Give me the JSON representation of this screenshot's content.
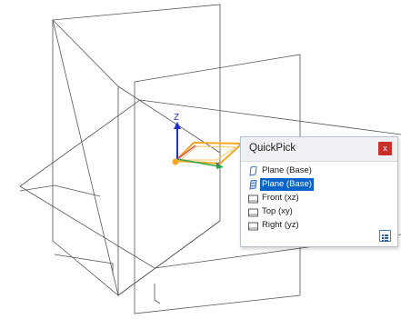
{
  "viewport": {
    "axis_label": "Z"
  },
  "quickpick": {
    "title": "QuickPick",
    "close_label": "x",
    "items": [
      {
        "label": "Plane (Base)",
        "icon": "plane-icon",
        "selected": false
      },
      {
        "label": "Plane (Base)",
        "icon": "plane-filled-icon",
        "selected": true
      },
      {
        "label": "Front (xz)",
        "icon": "reference-plane-icon",
        "selected": false
      },
      {
        "label": "Top (xy)",
        "icon": "reference-plane-icon",
        "selected": false
      },
      {
        "label": "Right (yz)",
        "icon": "reference-plane-icon",
        "selected": false
      }
    ],
    "footer_icon": "list-options-icon"
  },
  "colors": {
    "highlight": "#f5a623",
    "axis_z": "#1f2fd0",
    "axis_x": "#e23c3c",
    "axis_y": "#2fa84f",
    "selection": "#0a63c9"
  }
}
